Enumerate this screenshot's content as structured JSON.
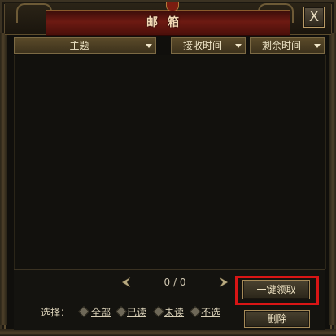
{
  "window": {
    "title": "邮箱",
    "close_label": "X"
  },
  "columns": {
    "subject": "主题",
    "received_time": "接收时间",
    "remaining_time": "剩余时间"
  },
  "mail_list": [],
  "pager": {
    "text": "0 / 0"
  },
  "buttons": {
    "collect_all": "一键领取",
    "delete": "删除"
  },
  "filter": {
    "label": "选择：",
    "options": [
      "全部",
      "已读",
      "未读",
      "不选"
    ]
  },
  "colors": {
    "highlight": "#d81515",
    "title_plate": "#6d1a12",
    "header": "#5a4a29"
  }
}
